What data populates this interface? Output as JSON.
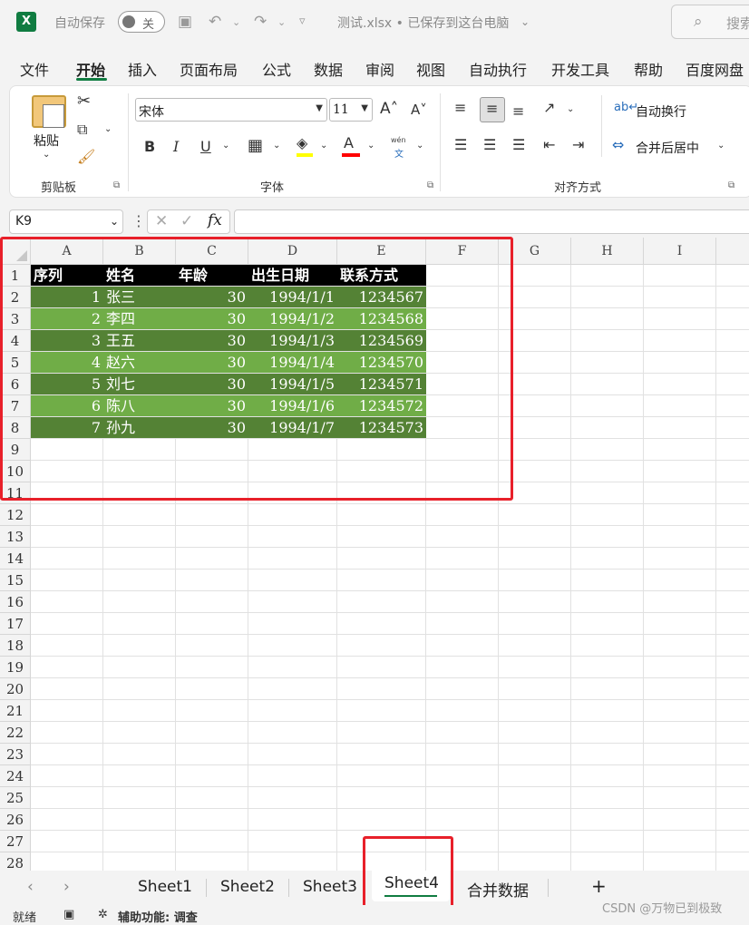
{
  "titlebar": {
    "autosave_label": "自动保存",
    "autosave_state": "关",
    "doc_title": "测试.xlsx • 已保存到这台电脑",
    "search_placeholder": "搜索"
  },
  "ribbon_tabs": [
    "文件",
    "开始",
    "插入",
    "页面布局",
    "公式",
    "数据",
    "审阅",
    "视图",
    "自动执行",
    "开发工具",
    "帮助",
    "百度网盘"
  ],
  "active_tab": "开始",
  "ribbon": {
    "clipboard": {
      "paste_label": "粘贴",
      "group_label": "剪贴板"
    },
    "font": {
      "font_name": "宋体",
      "font_size": "11",
      "group_label": "字体",
      "bold": "B",
      "italic": "I",
      "underline": "U",
      "pinyin_top": "wén",
      "pinyin_bottom": "文",
      "font_color_glyph": "A"
    },
    "alignment": {
      "wrap_text": "自动换行",
      "merge_center": "合并后居中",
      "group_label": "对齐方式"
    }
  },
  "formula_bar": {
    "name_box": "K9",
    "fx": "fx",
    "content": ""
  },
  "columns": [
    "A",
    "B",
    "C",
    "D",
    "E",
    "F",
    "G",
    "H",
    "I"
  ],
  "row_numbers": [
    "1",
    "2",
    "3",
    "4",
    "5",
    "6",
    "7",
    "8",
    "9",
    "10",
    "11",
    "12",
    "13",
    "14",
    "15",
    "16",
    "17",
    "18",
    "19",
    "20",
    "21",
    "22",
    "23",
    "24",
    "25",
    "26",
    "27",
    "28"
  ],
  "table": {
    "headers": [
      "序列",
      "姓名",
      "年龄",
      "出生日期",
      "联系方式"
    ],
    "rows": [
      [
        "1",
        "张三",
        "30",
        "1994/1/1",
        "1234567"
      ],
      [
        "2",
        "李四",
        "30",
        "1994/1/2",
        "1234568"
      ],
      [
        "3",
        "王五",
        "30",
        "1994/1/3",
        "1234569"
      ],
      [
        "4",
        "赵六",
        "30",
        "1994/1/4",
        "1234570"
      ],
      [
        "5",
        "刘七",
        "30",
        "1994/1/5",
        "1234571"
      ],
      [
        "6",
        "陈八",
        "30",
        "1994/1/6",
        "1234572"
      ],
      [
        "7",
        "孙九",
        "30",
        "1994/1/7",
        "1234573"
      ]
    ]
  },
  "colors": {
    "header_row_bg": "#000000",
    "dark_row_bg": "#548235",
    "light_row_bg": "#70ad47",
    "accent": "#107c41",
    "highlight_red": "#e8202a"
  },
  "sheets": [
    "Sheet1",
    "Sheet2",
    "Sheet3",
    "Sheet4",
    "合并数据"
  ],
  "active_sheet": "Sheet4",
  "add_sheet": "+",
  "statusbar": {
    "ready": "就绪",
    "accessibility": "辅助功能: 调查"
  },
  "watermark": "CSDN @万物已到极致"
}
